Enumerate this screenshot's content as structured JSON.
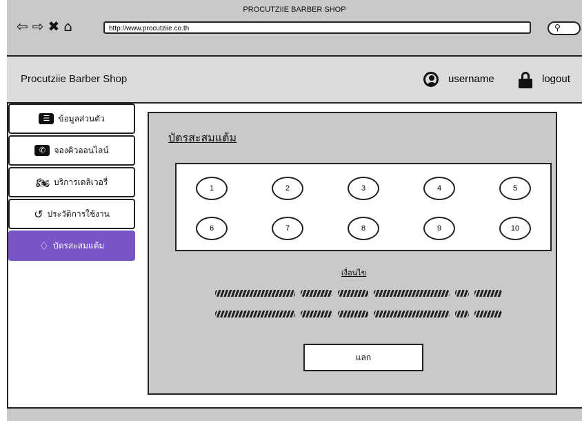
{
  "browser": {
    "title": "PROCUTZIIE BARBER SHOP",
    "url": "http://www.procutziie.co.th",
    "search_icon": "search-icon"
  },
  "header": {
    "brand": "Procutziie Barber Shop",
    "username": "username",
    "logout": "logout"
  },
  "sidebar": {
    "items": [
      {
        "label": "ข้อมูลส่วนตัว",
        "icon": "id-card-icon"
      },
      {
        "label": "จองคิวออนไลน์",
        "icon": "phone-icon"
      },
      {
        "label": "บริการเดลิเวอรี่",
        "icon": "motorbike-icon"
      },
      {
        "label": "ประวัติการใช้งาน",
        "icon": "history-icon"
      },
      {
        "label": "บัตรสะสมแต้ม",
        "icon": "diamond-icon",
        "active": true
      }
    ]
  },
  "card": {
    "title": "บัตรสะสมแต้ม",
    "stamps": [
      "1",
      "2",
      "3",
      "4",
      "5",
      "6",
      "7",
      "8",
      "9",
      "10"
    ],
    "conditions_title": "เงื่อนไข",
    "redeem_label": "แลก"
  },
  "colors": {
    "active": "#7855c6",
    "panel": "#c9c9c9",
    "header": "#dcdcdc"
  }
}
